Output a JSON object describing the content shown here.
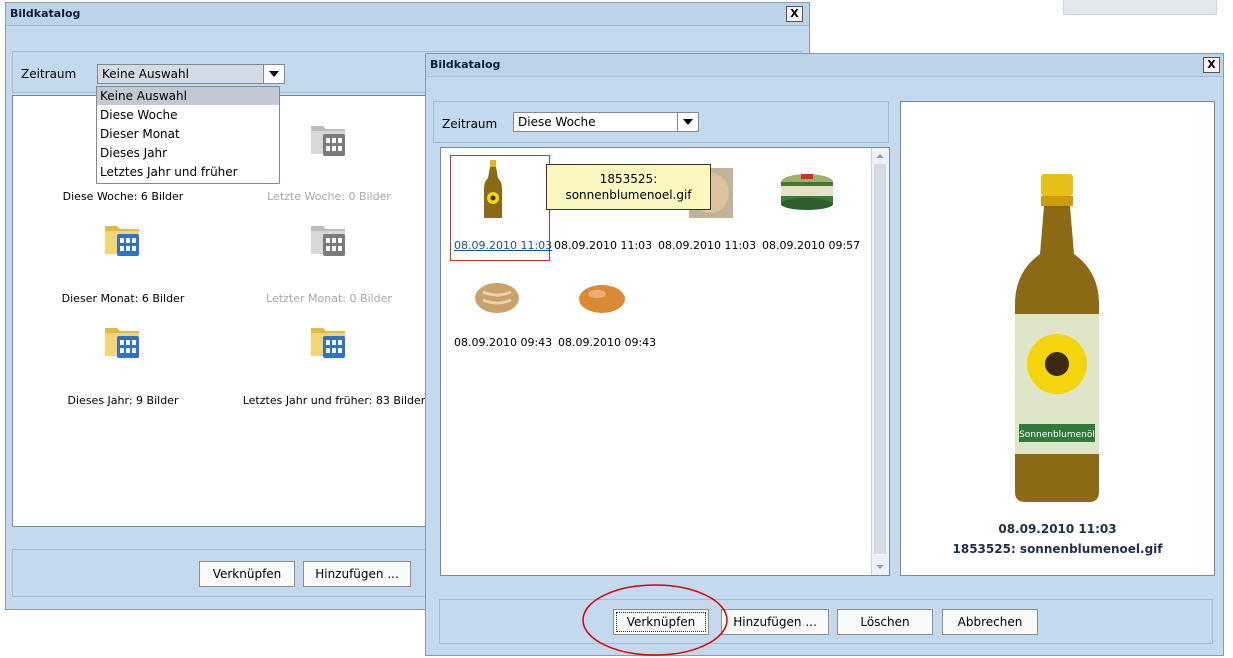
{
  "window_back": {
    "title": "Bildkatalog",
    "close_label": "X",
    "zeitraum_label": "Zeitraum",
    "combo_value": "Keine Auswahl",
    "dropdown_options": [
      "Keine Auswahl",
      "Diese Woche",
      "Dieser Monat",
      "Dieses Jahr",
      "Letztes Jahr und früher"
    ],
    "folders": [
      {
        "caption": "Diese Woche: 6 Bilder",
        "enabled": true
      },
      {
        "caption": "Letzte Woche: 0 Bilder",
        "enabled": false
      },
      {
        "caption": "Dieser Monat: 6 Bilder",
        "enabled": true
      },
      {
        "caption": "Letzter Monat: 0 Bilder",
        "enabled": false
      },
      {
        "caption": "Dieses Jahr: 9 Bilder",
        "enabled": true
      },
      {
        "caption": "Letztes Jahr und früher: 83 Bilder",
        "enabled": true
      }
    ],
    "buttons": {
      "link": "Verknüpfen",
      "add": "Hinzufügen ..."
    }
  },
  "window_front": {
    "title": "Bildkatalog",
    "close_label": "X",
    "zeitraum_label": "Zeitraum",
    "combo_value": "Diese Woche",
    "tooltip": {
      "line1": "1853525:",
      "line2": "sonnenblumenoel.gif"
    },
    "thumbnails": [
      {
        "caption": "08.09.2010 11:03",
        "image": "oil-bottle-thumb",
        "selected": true
      },
      {
        "caption": "08.09.2010 11:03",
        "image": "bread-thumb",
        "selected": false
      },
      {
        "caption": "08.09.2010 11:03",
        "image": "pastry-thumb",
        "selected": false
      },
      {
        "caption": "08.09.2010 09:57",
        "image": "can-thumb",
        "selected": false
      },
      {
        "caption": "08.09.2010 09:43",
        "image": "roll-thumb",
        "selected": false
      },
      {
        "caption": "08.09.2010 09:43",
        "image": "bun-thumb",
        "selected": false
      }
    ],
    "preview": {
      "date": "08.09.2010 11:03",
      "name": "1853525: sonnenblumenoel.gif",
      "bottle_label": "Sonnenblumenöl"
    },
    "buttons": {
      "link": "Verknüpfen",
      "add": "Hinzufügen ...",
      "delete": "Löschen",
      "cancel": "Abbrechen"
    }
  },
  "colors": {
    "window_bg": "#c5d9ee",
    "highlight_circle": "#d40000",
    "selection_border": "#c0392b",
    "link_text": "#1a4fa0"
  }
}
